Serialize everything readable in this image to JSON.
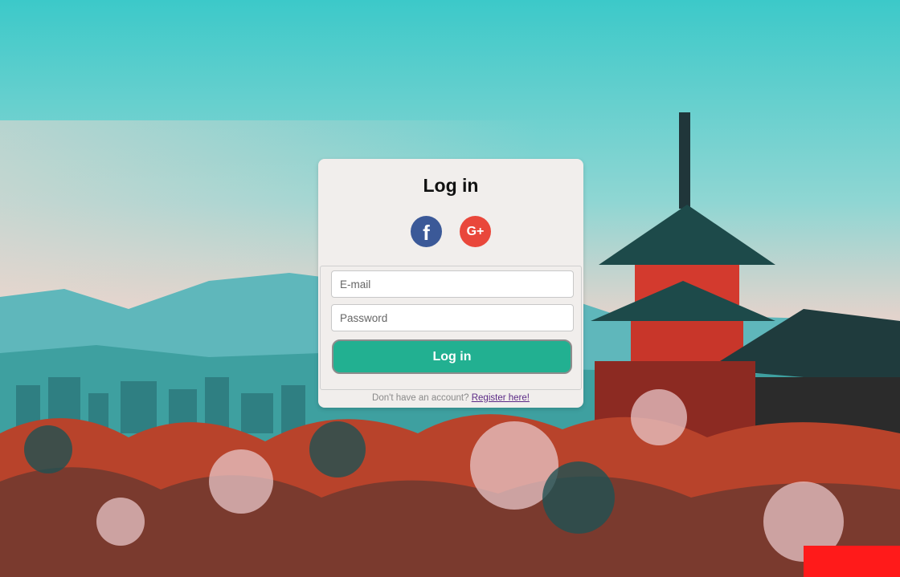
{
  "login": {
    "title": "Log in",
    "email_placeholder": "E-mail",
    "password_placeholder": "Password",
    "submit_label": "Log in",
    "register_prompt": "Don't have an account?",
    "register_link": "Register here!"
  },
  "social": {
    "facebook_glyph": "f",
    "google_glyph": "G+"
  },
  "colors": {
    "accent": "#22b091",
    "facebook": "#3b5998",
    "google": "#e9473b",
    "card": "#f1eeec"
  }
}
